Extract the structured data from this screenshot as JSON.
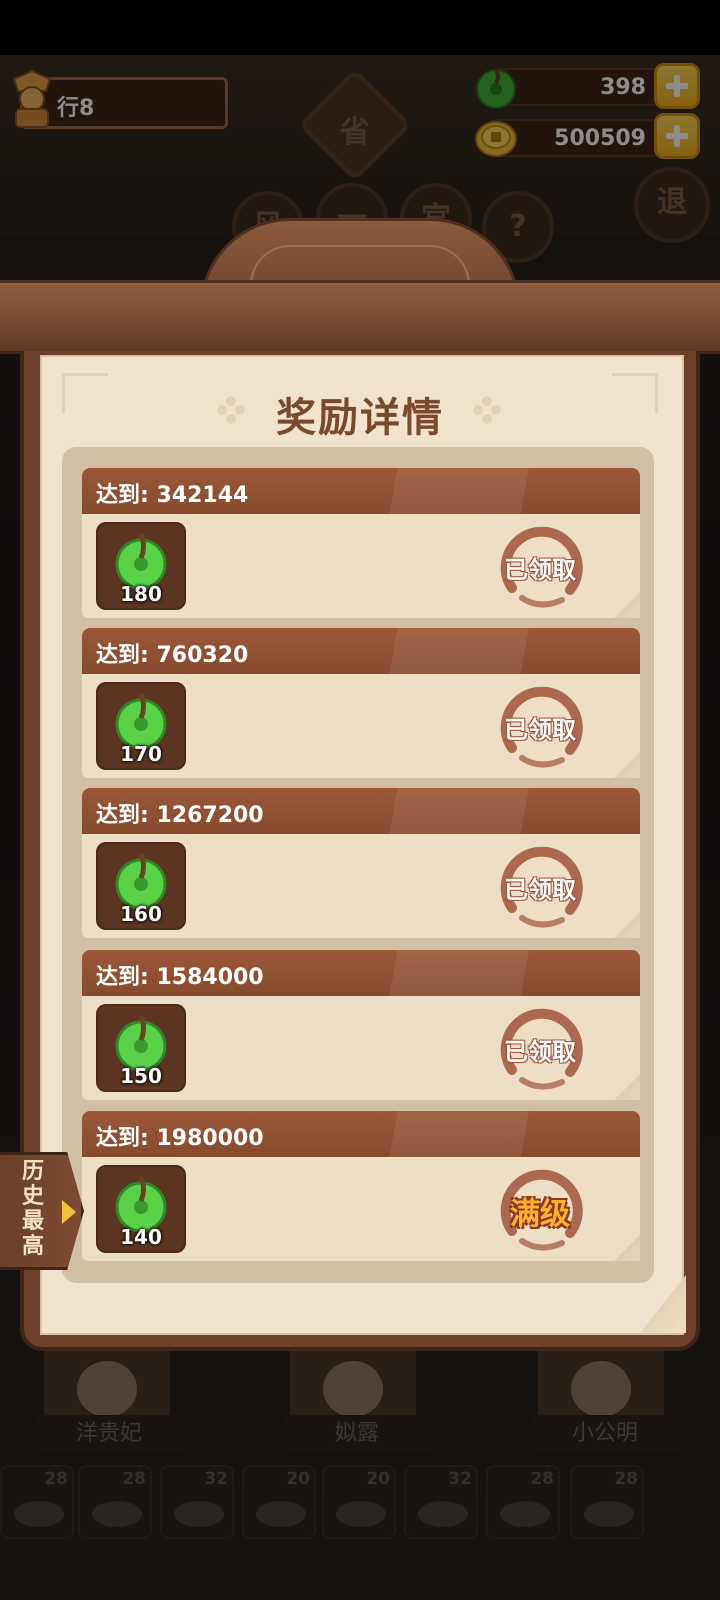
{
  "hud": {
    "player_name": "行8",
    "jade_amount": "398",
    "coin_amount": "500509",
    "jade_icon": "jade-disc-icon",
    "coin_icon": "coin-icon",
    "plus_icon": "plus-icon"
  },
  "background": {
    "badge_text": "省",
    "circle_buttons": [
      "风",
      "一",
      "宫",
      "?"
    ],
    "exit_button": "退",
    "characters": [
      {
        "name": "洋贵妃"
      },
      {
        "name": "姒露"
      },
      {
        "name": "小公明"
      }
    ],
    "dish_counts": [
      "28",
      "28",
      "32",
      "20",
      "20",
      "32",
      "28",
      "28"
    ]
  },
  "panel": {
    "title": "奖励详情",
    "rows": [
      {
        "label": "达到: 342144",
        "reward_count": "180",
        "status": "已领取"
      },
      {
        "label": "达到: 760320",
        "reward_count": "170",
        "status": "已领取"
      },
      {
        "label": "达到: 1267200",
        "reward_count": "160",
        "status": "已领取"
      },
      {
        "label": "达到: 1584000",
        "reward_count": "150",
        "status": "已领取"
      },
      {
        "label": "达到: 1980000",
        "reward_count": "140",
        "status": "满级"
      }
    ]
  },
  "history_tab": {
    "label": "历史最高"
  },
  "colors": {
    "row_header": "#874a2e",
    "paper": "#f1e3cd",
    "frame_wood": "#6d402b",
    "stamp_red": "#a0553a",
    "max_level_gold": "#ffb02e",
    "plus_button": "#f3b21c"
  }
}
